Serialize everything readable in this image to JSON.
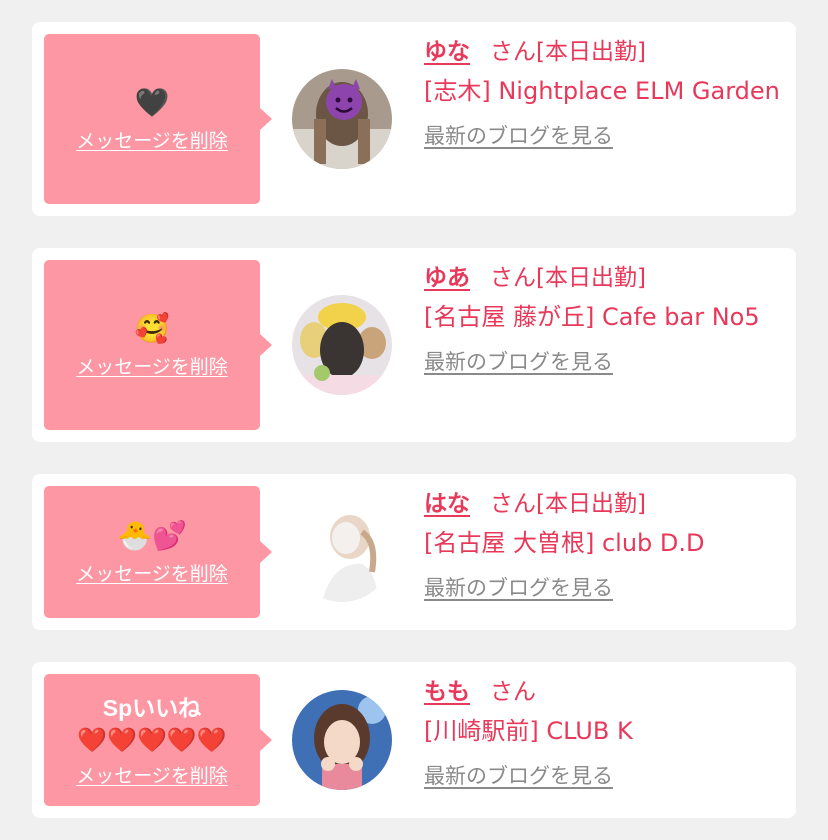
{
  "cards": [
    {
      "message_emojis": "🖤",
      "message_title": "",
      "delete_label": "メッセージを削除",
      "name": "ゆな",
      "suffix": "さん",
      "status": "[本日出勤]",
      "shop": "[志木] Nightplace ELM Garden",
      "blog_label": "最新のブログを見る"
    },
    {
      "message_emojis": "🥰",
      "message_title": "",
      "delete_label": "メッセージを削除",
      "name": "ゆあ",
      "suffix": "さん",
      "status": "[本日出勤]",
      "shop": "[名古屋 藤が丘] Cafe bar No5",
      "blog_label": "最新のブログを見る"
    },
    {
      "message_emojis": "🐣💕",
      "message_title": "",
      "delete_label": "メッセージを削除",
      "name": "はな",
      "suffix": "さん",
      "status": "[本日出勤]",
      "shop": "[名古屋 大曽根] club D.D",
      "blog_label": "最新のブログを見る"
    },
    {
      "message_emojis": "❤️❤️❤️❤️❤️",
      "message_title": "Spいいね",
      "delete_label": "メッセージを削除",
      "name": "もも",
      "suffix": "さん",
      "status": "",
      "shop": "[川崎駅前] CLUB K",
      "blog_label": "最新のブログを見る"
    }
  ],
  "colors": {
    "page_bg": "#f0f0f0",
    "bubble": "#fe97a4",
    "accent_text": "#e8395a",
    "link_gray": "#8a8a8a"
  }
}
